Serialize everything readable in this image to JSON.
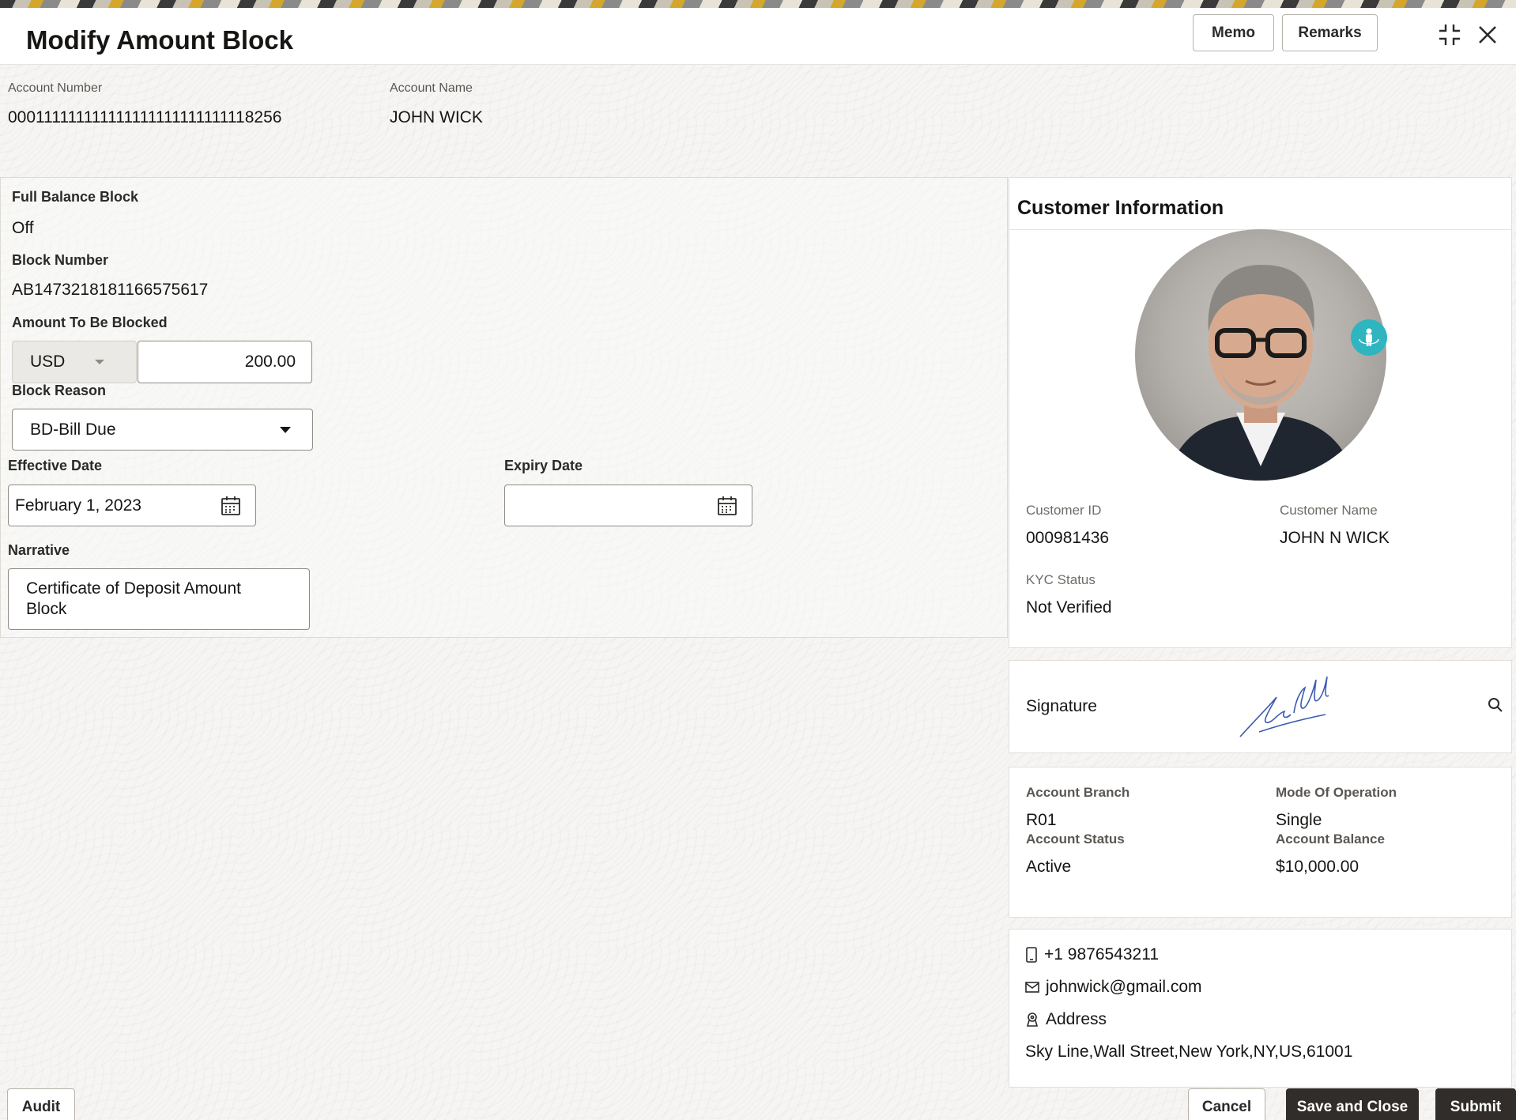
{
  "header": {
    "title": "Modify Amount Block",
    "memo_label": "Memo",
    "remarks_label": "Remarks"
  },
  "account": {
    "number_label": "Account Number",
    "number_value": "000111111111111111111111111118256",
    "name_label": "Account Name",
    "name_value": "JOHN WICK"
  },
  "form": {
    "full_balance_label": "Full Balance Block",
    "full_balance_value": "Off",
    "block_number_label": "Block Number",
    "block_number_value": "AB1473218181166575617",
    "amount_label": "Amount To Be Blocked",
    "currency_value": "USD",
    "amount_value": "200.00",
    "block_reason_label": "Block Reason",
    "block_reason_value": "BD-Bill Due",
    "effective_date_label": "Effective Date",
    "effective_date_value": "February 1, 2023",
    "expiry_date_label": "Expiry Date",
    "expiry_date_value": "",
    "narrative_label": "Narrative",
    "narrative_value": "Certificate of Deposit Amount Block"
  },
  "customer": {
    "title": "Customer Information",
    "id_label": "Customer ID",
    "id_value": "000981436",
    "name_label": "Customer Name",
    "name_value": "JOHN N WICK",
    "kyc_label": "KYC Status",
    "kyc_value": "Not Verified"
  },
  "signature": {
    "label": "Signature"
  },
  "account_details": {
    "branch_label": "Account Branch",
    "branch_value": "R01",
    "mode_label": "Mode Of Operation",
    "mode_value": "Single",
    "status_label": "Account Status",
    "status_value": "Active",
    "balance_label": "Account Balance",
    "balance_value": "$10,000.00"
  },
  "contact": {
    "phone": "+1 9876543211",
    "email": "johnwick@gmail.com",
    "address_label": "Address",
    "address_value": "Sky Line,Wall Street,New York,NY,US,61001"
  },
  "footer": {
    "audit_label": "Audit",
    "cancel_label": "Cancel",
    "save_close_label": "Save and Close",
    "submit_label": "Submit"
  },
  "icons": {
    "minimize": "minimize-icon",
    "close": "close-icon",
    "calendar": "calendar-icon",
    "search": "search-icon",
    "phone": "phone-icon",
    "mail": "mail-icon",
    "location": "location-icon",
    "view360": "view-360-icon"
  },
  "colors": {
    "primary_button": "#312d2a",
    "badge": "#2fb5c0",
    "signature_ink": "#3c5bb0"
  }
}
